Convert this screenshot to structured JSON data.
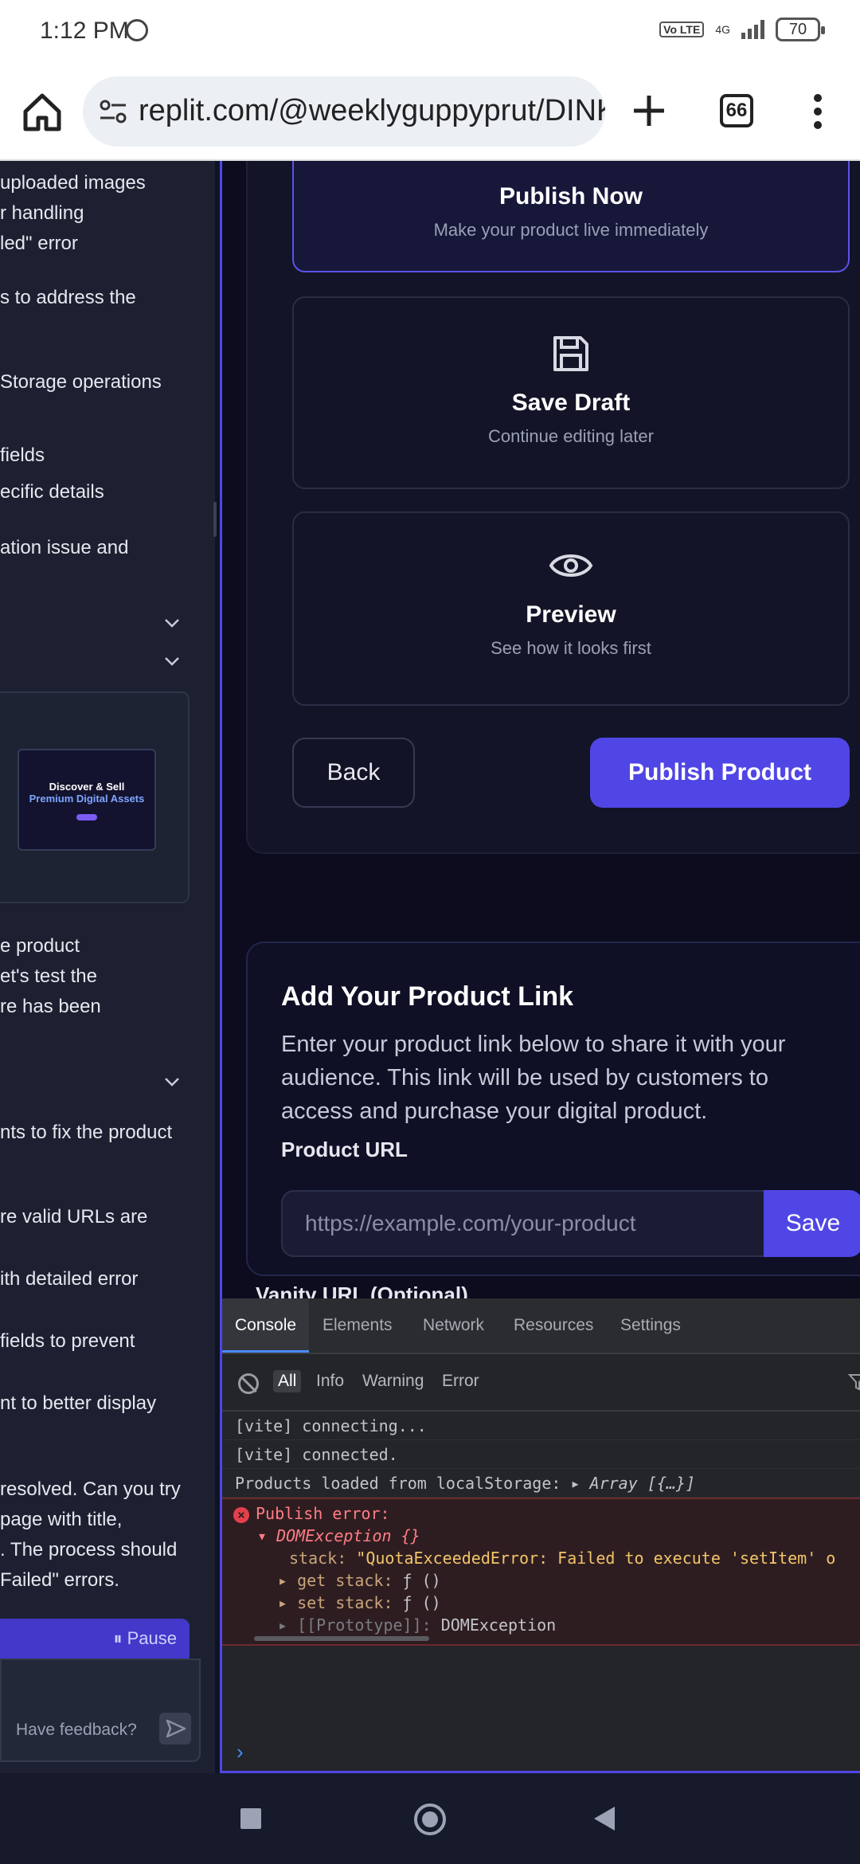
{
  "status_bar": {
    "time": "1:12 PM",
    "network": "4G",
    "volte": "Vo LTE",
    "battery": "70"
  },
  "browser": {
    "url": "replit.com/@weeklyguppyprut/DINK",
    "tab_count": "66"
  },
  "chat": {
    "lines": [
      "uploaded images",
      "r handling",
      "led\" error",
      "s to address the",
      "Storage operations",
      "fields",
      "ecific details",
      "ation issue and",
      "e product",
      "et's test the",
      "re has been",
      "nts to fix the product",
      "re valid URLs are",
      "ith detailed error",
      "fields to prevent",
      "nt to better display",
      "resolved. Can you try",
      "page with title,",
      ". The process should",
      "Failed\" errors."
    ],
    "thumbnail": {
      "line1": "Discover & Sell",
      "line2": "Premium Digital Assets"
    },
    "pause_label": "⏸ Pause",
    "feedback_placeholder": "Have feedback?"
  },
  "publish_options": [
    {
      "title": "Publish Now",
      "subtitle": "Make your product live immediately",
      "icon": "rocket-icon"
    },
    {
      "title": "Save Draft",
      "subtitle": "Continue editing later",
      "icon": "save-icon"
    },
    {
      "title": "Preview",
      "subtitle": "See how it looks first",
      "icon": "eye-icon"
    }
  ],
  "actions": {
    "back": "Back",
    "publish": "Publish Product"
  },
  "link_section": {
    "title": "Add Your Product Link",
    "description": "Enter your product link below to share it with your audience. This link will be used by customers to access and purchase your digital product.",
    "url_label": "Product URL",
    "url_placeholder": "https://example.com/your-product",
    "save": "Save",
    "vanity_label": "Vanity URL (Optional)"
  },
  "devtools": {
    "tabs": [
      "Console",
      "Elements",
      "Network",
      "Resources",
      "Settings"
    ],
    "filters": [
      "All",
      "Info",
      "Warning",
      "Error"
    ],
    "logs": [
      "[vite] connecting...",
      "[vite] connected."
    ],
    "products_log": "Products loaded from localStorage:",
    "products_value": "▸ Array [{…}]",
    "error": {
      "title": "Publish error:",
      "exception": "▾ DOMException {}",
      "stack_key": "stack:",
      "stack_value": "\"QuotaExceededError: Failed to execute 'setItem' o",
      "get_stack": "▸ get stack:",
      "set_stack": "▸ set stack:",
      "fn_value": "ƒ ()",
      "proto_key": "▸ [[Prototype]]:",
      "proto_value": "DOMException"
    },
    "prompt": "›"
  }
}
